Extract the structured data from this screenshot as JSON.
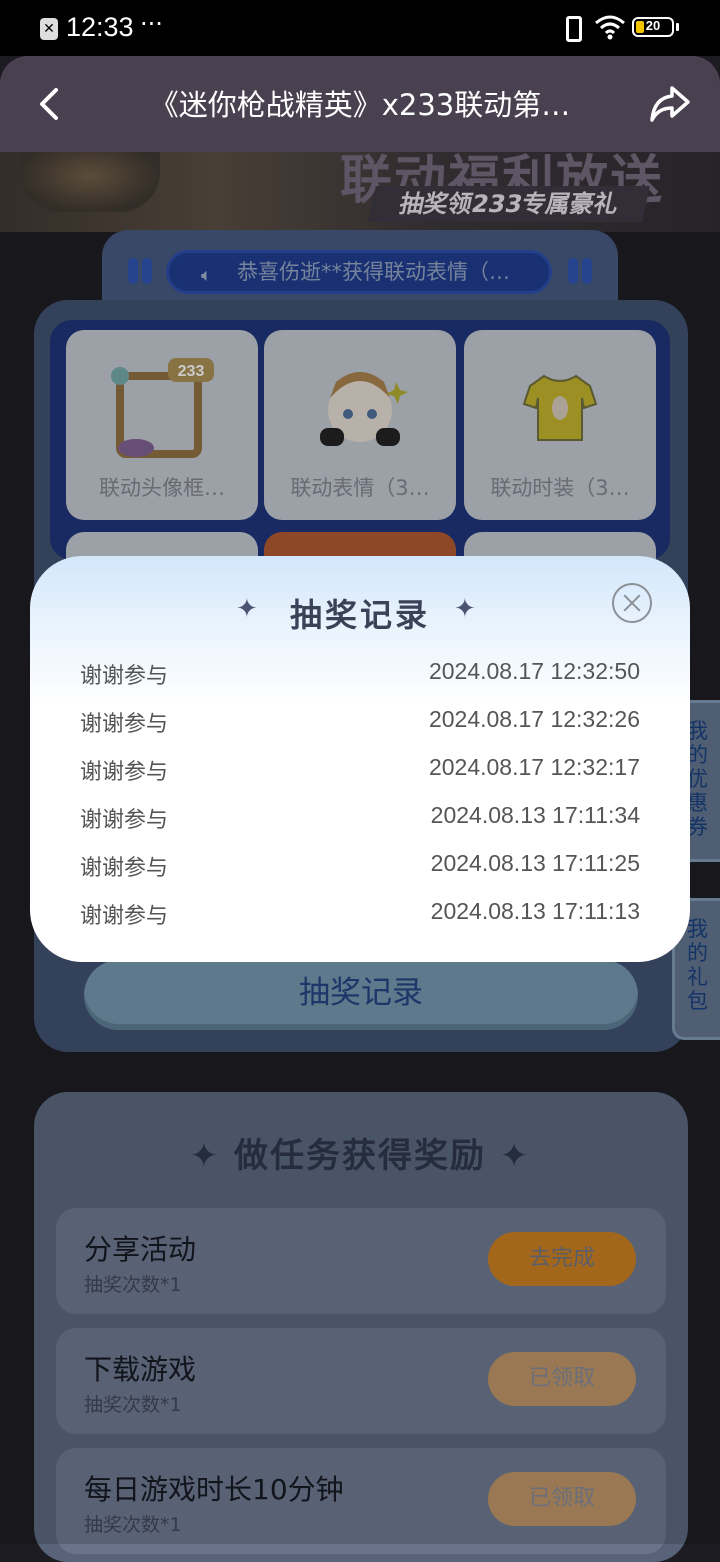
{
  "status_bar": {
    "time": "12:33",
    "dots": "···",
    "battery": "20"
  },
  "navbar": {
    "title": "《迷你枪战精英》x233联动第…"
  },
  "banner": {
    "headline": "联动福利放送",
    "subtitle": "抽奖领233专属豪礼"
  },
  "ticker": {
    "text": "恭喜伤逝**获得联动表情（…"
  },
  "prizes": [
    {
      "label": "联动头像框…",
      "icon": "avatar-frame-233-icon"
    },
    {
      "label": "联动表情（3…",
      "icon": "chibi-emote-icon"
    },
    {
      "label": "联动时装（3…",
      "icon": "yellow-shirt-icon"
    }
  ],
  "lottery_records_button": {
    "label": "抽奖记录"
  },
  "side_tabs": {
    "coupons": "我的优惠券",
    "gifts": "我的礼包"
  },
  "tasks": {
    "title": "做任务获得奖励",
    "items": [
      {
        "name": "分享活动",
        "reward": "抽奖次数*1",
        "button": "去完成"
      },
      {
        "name": "下载游戏",
        "reward": "抽奖次数*1",
        "button": "已领取"
      },
      {
        "name": "每日游戏时长10分钟",
        "reward": "抽奖次数*1",
        "button": "已领取"
      }
    ]
  },
  "modal": {
    "title": "抽奖记录",
    "records": [
      {
        "result": "谢谢参与",
        "time": "2024.08.17 12:32:50"
      },
      {
        "result": "谢谢参与",
        "time": "2024.08.17 12:32:26"
      },
      {
        "result": "谢谢参与",
        "time": "2024.08.17 12:32:17"
      },
      {
        "result": "谢谢参与",
        "time": "2024.08.13 17:11:34"
      },
      {
        "result": "谢谢参与",
        "time": "2024.08.13 17:11:25"
      },
      {
        "result": "谢谢参与",
        "time": "2024.08.13 17:11:13"
      }
    ]
  }
}
